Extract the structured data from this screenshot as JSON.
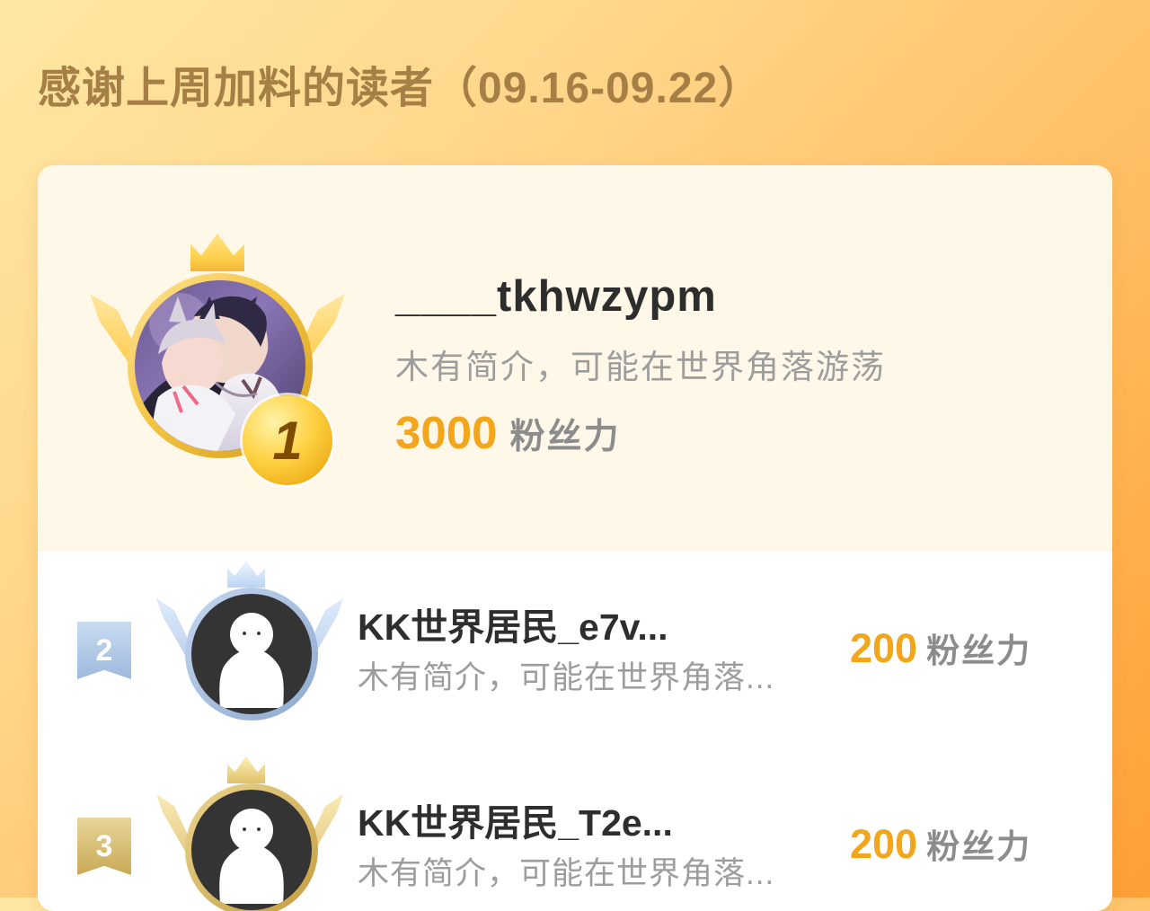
{
  "header": {
    "title": "感谢上周加料的读者（09.16-09.22）"
  },
  "colors": {
    "background_start": "#ffe7a3",
    "background_end": "#ff9f35",
    "title": "#a57f45",
    "accent": "#f2a61c",
    "silver": "#9eb9dd",
    "bronze": "#c8a955"
  },
  "icons": {
    "rank1_crown": "gold-crown-icon",
    "rank1_medal": "gold-medal-icon",
    "rank2_badge": "silver-rank-badge-icon",
    "rank3_badge": "bronze-rank-badge-icon",
    "default_avatar": "default-user-avatar-icon"
  },
  "leaders": [
    {
      "rank": "1",
      "name": "____tkhwzypm",
      "bio": "木有简介，可能在世界角落游荡",
      "fans_value": "3000",
      "fans_label": "粉丝力"
    },
    {
      "rank": "2",
      "name": "KK世界居民_e7v...",
      "bio": "木有简介，可能在世界角落...",
      "fans_value": "200",
      "fans_label": "粉丝力"
    },
    {
      "rank": "3",
      "name": "KK世界居民_T2e...",
      "bio": "木有简介，可能在世界角落...",
      "fans_value": "200",
      "fans_label": "粉丝力"
    }
  ]
}
